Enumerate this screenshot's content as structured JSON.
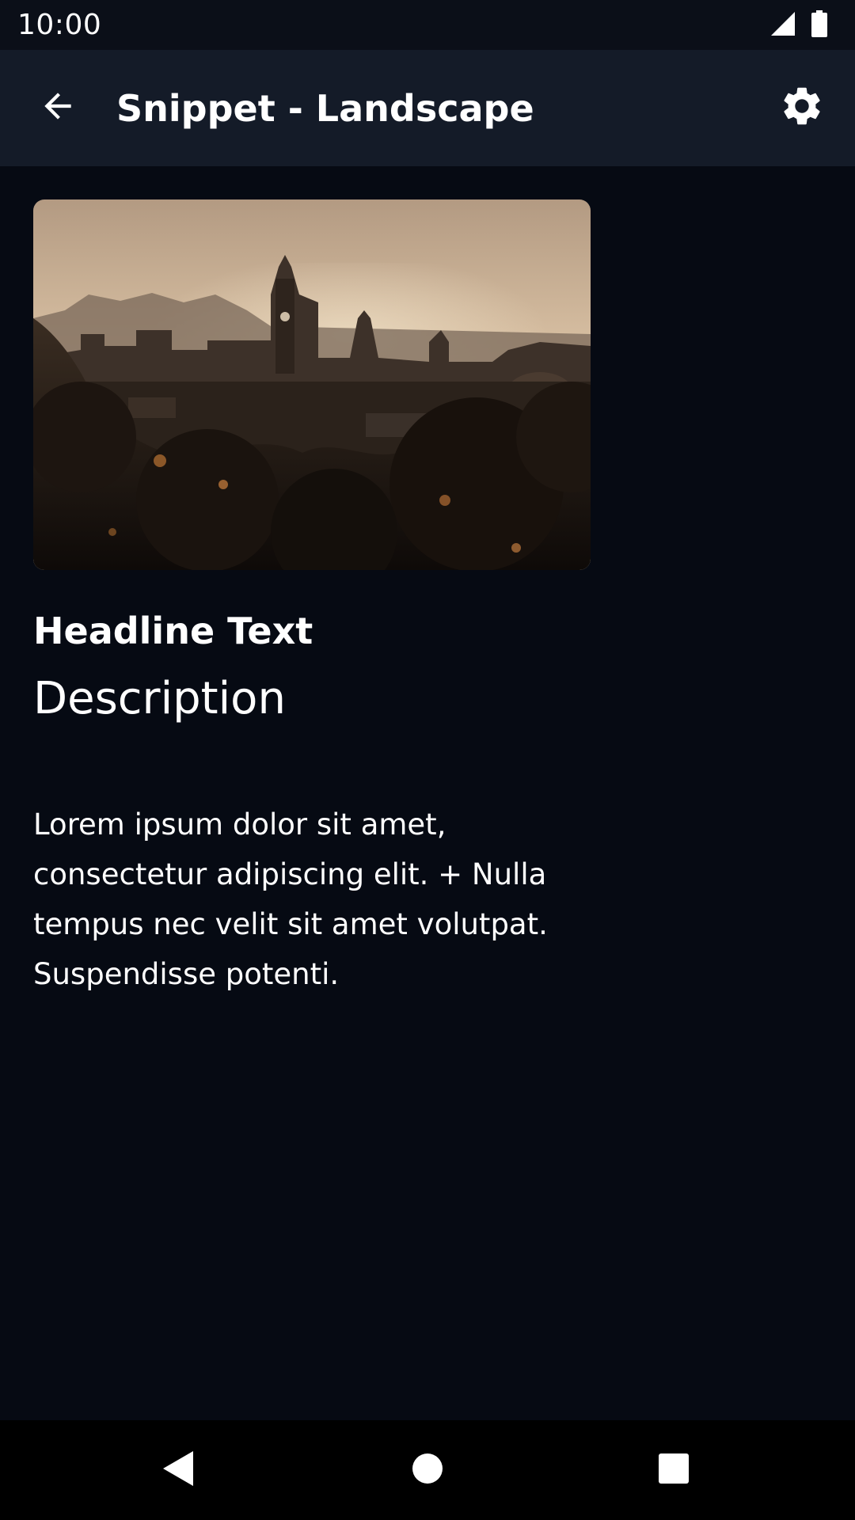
{
  "status_bar": {
    "time": "10:00"
  },
  "app_bar": {
    "title": "Snippet - Landscape"
  },
  "content": {
    "headline": "Headline Text",
    "description": "Description",
    "body": "Lorem ipsum dolor sit amet, consectetur adipiscing elit. + Nulla tempus nec velit sit amet volutpat. Suspendisse potenti."
  },
  "icons": {
    "signal": "signal-icon",
    "battery": "battery-icon",
    "back": "arrow-back-icon",
    "settings": "gear-icon",
    "nav_back": "nav-back-triangle-icon",
    "nav_home": "nav-home-circle-icon",
    "nav_recents": "nav-recents-square-icon"
  },
  "colors": {
    "background": "#060a13",
    "app_bar": "#141b28",
    "status_bar": "#0b0f18",
    "nav_bar": "#000000",
    "text": "#ffffff"
  }
}
